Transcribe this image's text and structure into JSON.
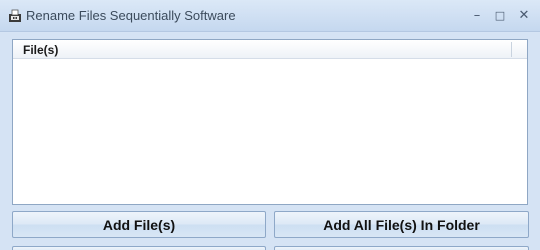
{
  "window": {
    "title": "Rename Files Sequentially Software",
    "icon": "app-icon",
    "controls": {
      "minimize": "–",
      "maximize": "□",
      "close": "✕"
    }
  },
  "file_list": {
    "columns": [
      "File(s)"
    ],
    "rows": []
  },
  "buttons": {
    "add_files": "Add File(s)",
    "add_folder": "Add All File(s) In Folder"
  },
  "colors": {
    "titlebar": "#c5d8ef",
    "client_bg": "#d5e3f4",
    "button_border": "#8ea8c8"
  }
}
